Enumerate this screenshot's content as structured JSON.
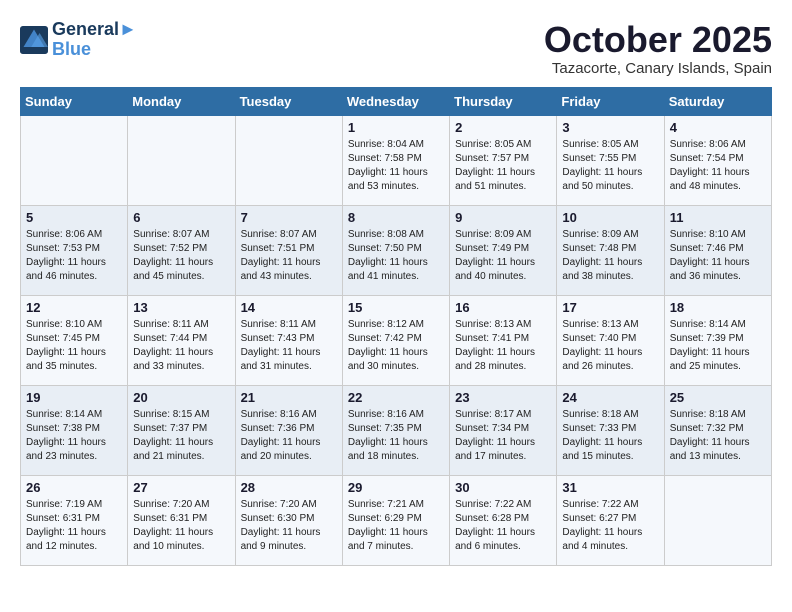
{
  "header": {
    "logo_line1": "General",
    "logo_line2": "Blue",
    "month_title": "October 2025",
    "subtitle": "Tazacorte, Canary Islands, Spain"
  },
  "days_of_week": [
    "Sunday",
    "Monday",
    "Tuesday",
    "Wednesday",
    "Thursday",
    "Friday",
    "Saturday"
  ],
  "weeks": [
    [
      {
        "day": "",
        "detail": ""
      },
      {
        "day": "",
        "detail": ""
      },
      {
        "day": "",
        "detail": ""
      },
      {
        "day": "1",
        "detail": "Sunrise: 8:04 AM\nSunset: 7:58 PM\nDaylight: 11 hours\nand 53 minutes."
      },
      {
        "day": "2",
        "detail": "Sunrise: 8:05 AM\nSunset: 7:57 PM\nDaylight: 11 hours\nand 51 minutes."
      },
      {
        "day": "3",
        "detail": "Sunrise: 8:05 AM\nSunset: 7:55 PM\nDaylight: 11 hours\nand 50 minutes."
      },
      {
        "day": "4",
        "detail": "Sunrise: 8:06 AM\nSunset: 7:54 PM\nDaylight: 11 hours\nand 48 minutes."
      }
    ],
    [
      {
        "day": "5",
        "detail": "Sunrise: 8:06 AM\nSunset: 7:53 PM\nDaylight: 11 hours\nand 46 minutes."
      },
      {
        "day": "6",
        "detail": "Sunrise: 8:07 AM\nSunset: 7:52 PM\nDaylight: 11 hours\nand 45 minutes."
      },
      {
        "day": "7",
        "detail": "Sunrise: 8:07 AM\nSunset: 7:51 PM\nDaylight: 11 hours\nand 43 minutes."
      },
      {
        "day": "8",
        "detail": "Sunrise: 8:08 AM\nSunset: 7:50 PM\nDaylight: 11 hours\nand 41 minutes."
      },
      {
        "day": "9",
        "detail": "Sunrise: 8:09 AM\nSunset: 7:49 PM\nDaylight: 11 hours\nand 40 minutes."
      },
      {
        "day": "10",
        "detail": "Sunrise: 8:09 AM\nSunset: 7:48 PM\nDaylight: 11 hours\nand 38 minutes."
      },
      {
        "day": "11",
        "detail": "Sunrise: 8:10 AM\nSunset: 7:46 PM\nDaylight: 11 hours\nand 36 minutes."
      }
    ],
    [
      {
        "day": "12",
        "detail": "Sunrise: 8:10 AM\nSunset: 7:45 PM\nDaylight: 11 hours\nand 35 minutes."
      },
      {
        "day": "13",
        "detail": "Sunrise: 8:11 AM\nSunset: 7:44 PM\nDaylight: 11 hours\nand 33 minutes."
      },
      {
        "day": "14",
        "detail": "Sunrise: 8:11 AM\nSunset: 7:43 PM\nDaylight: 11 hours\nand 31 minutes."
      },
      {
        "day": "15",
        "detail": "Sunrise: 8:12 AM\nSunset: 7:42 PM\nDaylight: 11 hours\nand 30 minutes."
      },
      {
        "day": "16",
        "detail": "Sunrise: 8:13 AM\nSunset: 7:41 PM\nDaylight: 11 hours\nand 28 minutes."
      },
      {
        "day": "17",
        "detail": "Sunrise: 8:13 AM\nSunset: 7:40 PM\nDaylight: 11 hours\nand 26 minutes."
      },
      {
        "day": "18",
        "detail": "Sunrise: 8:14 AM\nSunset: 7:39 PM\nDaylight: 11 hours\nand 25 minutes."
      }
    ],
    [
      {
        "day": "19",
        "detail": "Sunrise: 8:14 AM\nSunset: 7:38 PM\nDaylight: 11 hours\nand 23 minutes."
      },
      {
        "day": "20",
        "detail": "Sunrise: 8:15 AM\nSunset: 7:37 PM\nDaylight: 11 hours\nand 21 minutes."
      },
      {
        "day": "21",
        "detail": "Sunrise: 8:16 AM\nSunset: 7:36 PM\nDaylight: 11 hours\nand 20 minutes."
      },
      {
        "day": "22",
        "detail": "Sunrise: 8:16 AM\nSunset: 7:35 PM\nDaylight: 11 hours\nand 18 minutes."
      },
      {
        "day": "23",
        "detail": "Sunrise: 8:17 AM\nSunset: 7:34 PM\nDaylight: 11 hours\nand 17 minutes."
      },
      {
        "day": "24",
        "detail": "Sunrise: 8:18 AM\nSunset: 7:33 PM\nDaylight: 11 hours\nand 15 minutes."
      },
      {
        "day": "25",
        "detail": "Sunrise: 8:18 AM\nSunset: 7:32 PM\nDaylight: 11 hours\nand 13 minutes."
      }
    ],
    [
      {
        "day": "26",
        "detail": "Sunrise: 7:19 AM\nSunset: 6:31 PM\nDaylight: 11 hours\nand 12 minutes."
      },
      {
        "day": "27",
        "detail": "Sunrise: 7:20 AM\nSunset: 6:31 PM\nDaylight: 11 hours\nand 10 minutes."
      },
      {
        "day": "28",
        "detail": "Sunrise: 7:20 AM\nSunset: 6:30 PM\nDaylight: 11 hours\nand 9 minutes."
      },
      {
        "day": "29",
        "detail": "Sunrise: 7:21 AM\nSunset: 6:29 PM\nDaylight: 11 hours\nand 7 minutes."
      },
      {
        "day": "30",
        "detail": "Sunrise: 7:22 AM\nSunset: 6:28 PM\nDaylight: 11 hours\nand 6 minutes."
      },
      {
        "day": "31",
        "detail": "Sunrise: 7:22 AM\nSunset: 6:27 PM\nDaylight: 11 hours\nand 4 minutes."
      },
      {
        "day": "",
        "detail": ""
      }
    ]
  ]
}
